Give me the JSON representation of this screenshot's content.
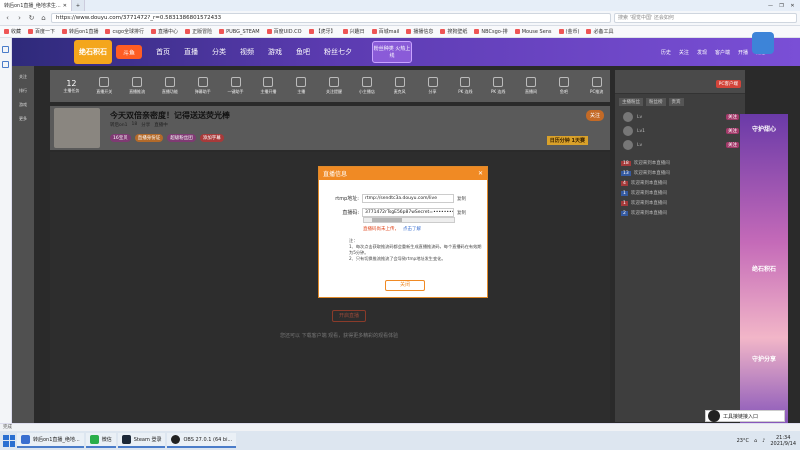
{
  "browser": {
    "tabs": [
      {
        "label": "转后on1直播_绝地求生..."
      },
      {
        "label": "+"
      }
    ],
    "url": "https://www.douyu.com/3771472?_r=0.5831386801572433",
    "search_placeholder": "搜索 '视觉中国' 还会如何",
    "window_controls": [
      "—",
      "❐",
      "✕"
    ],
    "bookmarks": [
      "收藏",
      "百度一下",
      "转后on1直播",
      "csgo全球排行",
      "直播中心",
      "正版冒险",
      "PUBG_STEAM",
      "百度UID.CO",
      "【虎牙】",
      "兴趣日",
      "百城mail",
      "播播信息",
      "搜狗壁纸",
      "NBCsgo-排",
      "Mouse Sens",
      "(金币)",
      "必备工具"
    ]
  },
  "douyu_nav": {
    "logo": "绝石积石",
    "logo2": "斗鱼",
    "items": [
      "首页",
      "直播",
      "分类",
      "视频",
      "游戏",
      "鱼吧",
      "粉丝七夕"
    ],
    "promo": "粉丝种类 火热上线",
    "right": [
      "历史",
      "关注",
      "发现",
      "客户端",
      "开播",
      "消息"
    ]
  },
  "room_toolbar": {
    "count": "12",
    "items": [
      "主播任务",
      "直播开关",
      "直播推流",
      "直播功能",
      "弹幕助手",
      "一键助手",
      "主播开播",
      "主播",
      "关注提醒",
      "小主播店",
      "麦克风",
      "分享",
      "PK 连线",
      "PK 连线",
      "直播间",
      "鱼吧",
      "PC推流"
    ]
  },
  "room": {
    "title": "今天双倍亲密度！记得送送荧光棒",
    "meta": [
      "转后on1",
      "18",
      "分享",
      "直播中"
    ],
    "tags": [
      "16宝贝",
      "直播身份证",
      "超级粉丝团",
      "添加字幕"
    ],
    "follow_label": "关注",
    "live_badge": "日历分钟 1天赛",
    "video_button": "开启直播",
    "video_hint": "您还可以 下载客户端 观看，获得更多精彩的观看体验"
  },
  "chat": {
    "pc_button": "PC客户端",
    "tabs": [
      "主播粉丝",
      "粉丝榜",
      "贵宾"
    ],
    "ranks": [
      {
        "name": "Lv",
        "badge": "关注"
      },
      {
        "name": "Lv1",
        "badge": "关注"
      },
      {
        "name": "Lv",
        "badge": "关注"
      }
    ],
    "messages": [
      {
        "level": "18",
        "text": "欢迎来到本直播间"
      },
      {
        "level": "13",
        "text": "欢迎来到本直播间"
      },
      {
        "level": "4",
        "text": "欢迎来到本直播间"
      },
      {
        "level": "1",
        "text": "欢迎来到本直播间"
      },
      {
        "level": "1",
        "text": "欢迎来到本直播间"
      },
      {
        "level": "2",
        "text": "欢迎来到本直播间"
      }
    ]
  },
  "ad": {
    "top": "守护甜心",
    "mid": "绝石积石",
    "bottom": "守护分享"
  },
  "dialog": {
    "title": "直播信息",
    "close": "✕",
    "rtmp_label": "rtmp地址:",
    "rtmp_value": "rtmp://sendtc3a.douyu.com/live",
    "key_label": "直播码:",
    "key_value": "3771472rTsgE56p87wSecret=••••••••",
    "copy_label": "复制",
    "warn": "直播码尚未上传，",
    "warn_link": "点击了解",
    "notes_title": "注：",
    "note1": "1、每次点击获取推流码都会重新生成直播推流码，每个直播码在有效期为5分钟。",
    "note2": "2、只有切换推流推流了会导致rtmp地址发生变化。",
    "ok_button": "关闭"
  },
  "status_text": "完成",
  "float_tool": "工具接链接入口",
  "taskbar": {
    "items": [
      "转后on1直播_绝地...",
      "微信",
      "Steam 登录",
      "OBS 27.0.1 (64 bi..."
    ],
    "weather": "23°C",
    "time": "21:34",
    "date": "2021/9/14"
  }
}
